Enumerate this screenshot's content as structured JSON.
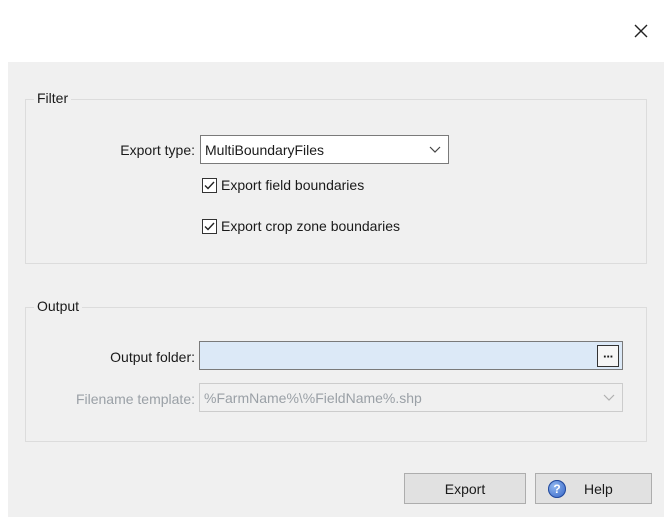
{
  "window": {
    "close_glyph": "✕"
  },
  "filter": {
    "legend": "Filter",
    "export_type_label": "Export type:",
    "export_type_value": "MultiBoundaryFiles",
    "export_field_boundaries": {
      "label": "Export field boundaries",
      "checked": true
    },
    "export_crop_zone_boundaries": {
      "label": "Export crop zone boundaries",
      "checked": true
    }
  },
  "output": {
    "legend": "Output",
    "folder_label": "Output folder:",
    "folder_value": "",
    "browse_glyph": "···",
    "template_label": "Filename template:",
    "template_value": "%FarmName%\\%FieldName%.shp"
  },
  "buttons": {
    "export_label": "Export",
    "help_label": "Help",
    "help_icon_glyph": "?"
  }
}
